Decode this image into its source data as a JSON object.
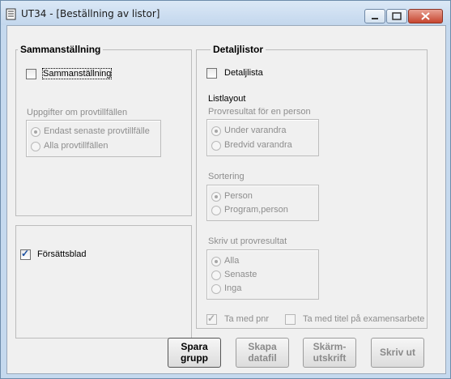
{
  "window": {
    "title": "UT34 - [Beställning av listor]"
  },
  "sammanstallning": {
    "group_title": "Sammanställning",
    "checkbox_label": "Sammanställning",
    "checked": false,
    "uppgifter_label": "Uppgifter om provtillfällen",
    "options": [
      "Endast senaste provtillfälle",
      "Alla provtillfällen"
    ],
    "selected": 0
  },
  "forsattsblad": {
    "label": "Försättsblad",
    "checked": true
  },
  "detaljlistor": {
    "group_title": "Detaljlistor",
    "checkbox_label": "Detaljlista",
    "checked": false,
    "listlayout_label": "Listlayout",
    "provresultat_label": "Provresultat för en person",
    "provresultat_options": [
      "Under varandra",
      "Bredvid varandra"
    ],
    "sortering_label": "Sortering",
    "sortering_options": [
      "Person",
      "Program,person"
    ],
    "skriv_label": "Skriv ut provresultat",
    "skriv_options": [
      "Alla",
      "Senaste",
      "Inga"
    ],
    "ta_med_pnr": "Ta med pnr",
    "ta_med_titel": "Ta med titel på examensarbete"
  },
  "buttons": {
    "spara": [
      "Spara",
      "grupp"
    ],
    "skapa": [
      "Skapa",
      "datafil"
    ],
    "skarm": [
      "Skärm-",
      "utskrift"
    ],
    "skriv": "Skriv ut"
  }
}
